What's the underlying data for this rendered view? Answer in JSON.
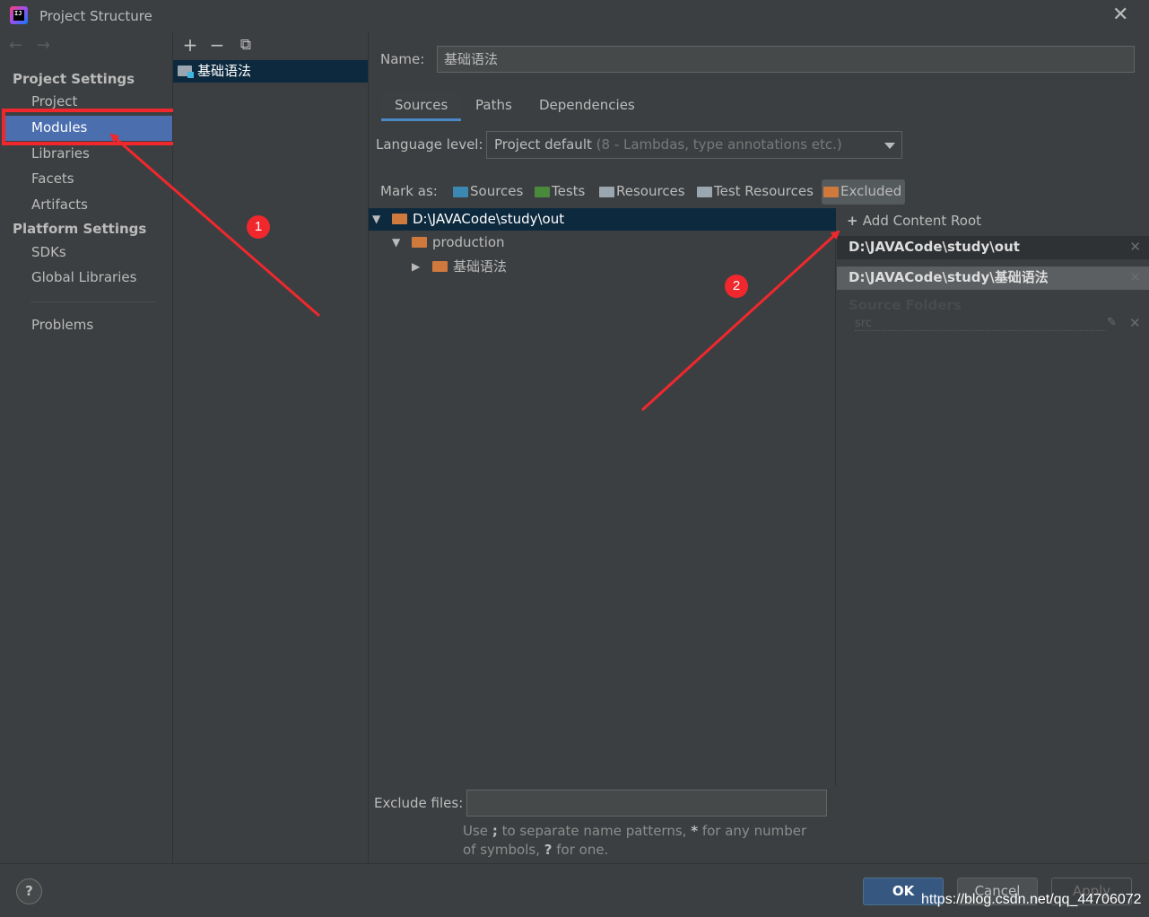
{
  "window": {
    "title": "Project Structure",
    "close_icon": "close-icon"
  },
  "nav": {
    "back_icon": "←",
    "forward_icon": "→",
    "project_settings_header": "Project Settings",
    "platform_settings_header": "Platform Settings",
    "items": {
      "project": "Project",
      "modules": "Modules",
      "libraries": "Libraries",
      "facets": "Facets",
      "artifacts": "Artifacts",
      "sdks": "SDKs",
      "global_libraries": "Global Libraries",
      "problems": "Problems"
    },
    "selected": "Modules"
  },
  "modules": {
    "toolbar": {
      "add": "+",
      "remove": "−",
      "copy": "⧉"
    },
    "list": [
      "基础语法"
    ]
  },
  "main": {
    "name_label": "Name:",
    "name_value": "基础语法",
    "tabs": [
      "Sources",
      "Paths",
      "Dependencies"
    ],
    "active_tab": "Sources",
    "language_label": "Language level:",
    "language_value": "Project default",
    "language_detail": "(8 - Lambdas, type annotations etc.)",
    "mark_as_label": "Mark as:",
    "mark_buttons": [
      {
        "label": "Sources",
        "color": "#3b89b3"
      },
      {
        "label": "Tests",
        "color": "#4b8a3c"
      },
      {
        "label": "Resources",
        "color": "#9aa7b0"
      },
      {
        "label": "Test Resources",
        "color": "#9aa7b0"
      },
      {
        "label": "Excluded",
        "color": "#d0793d"
      }
    ],
    "tree": [
      {
        "label": "D:\\JAVACode\\study\\out",
        "expanded": true
      },
      {
        "label": "production",
        "expanded": true
      },
      {
        "label": "基础语法",
        "expanded": false
      }
    ],
    "add_content_root": "Add Content Root",
    "content_roots": [
      "D:\\JAVACode\\study\\out",
      "D:\\JAVACode\\study\\基础语法"
    ],
    "source_folders_header": "Source Folders",
    "source_folder_item": "src",
    "exclude_label": "Exclude files:",
    "exclude_value": "",
    "exclude_hint_1": "Use",
    "exclude_hint_sep": ";",
    "exclude_hint_2": "to separate name patterns,",
    "exclude_hint_star": "*",
    "exclude_hint_3": "for any number of symbols,",
    "exclude_hint_q": "?",
    "exclude_hint_4": "for one."
  },
  "footer": {
    "help": "?",
    "ok": "OK",
    "cancel": "Cancel",
    "apply": "Apply",
    "watermark": "https://blog.csdn.net/qq_44706072"
  },
  "annotations": {
    "badge_1": "1",
    "badge_2": "2",
    "accent": "#f0282d"
  },
  "colors": {
    "selection": "#4b6eaf",
    "tree_selection": "#0d293e",
    "folder_excluded": "#d0793d",
    "tab_underline": "#4a88c7"
  }
}
